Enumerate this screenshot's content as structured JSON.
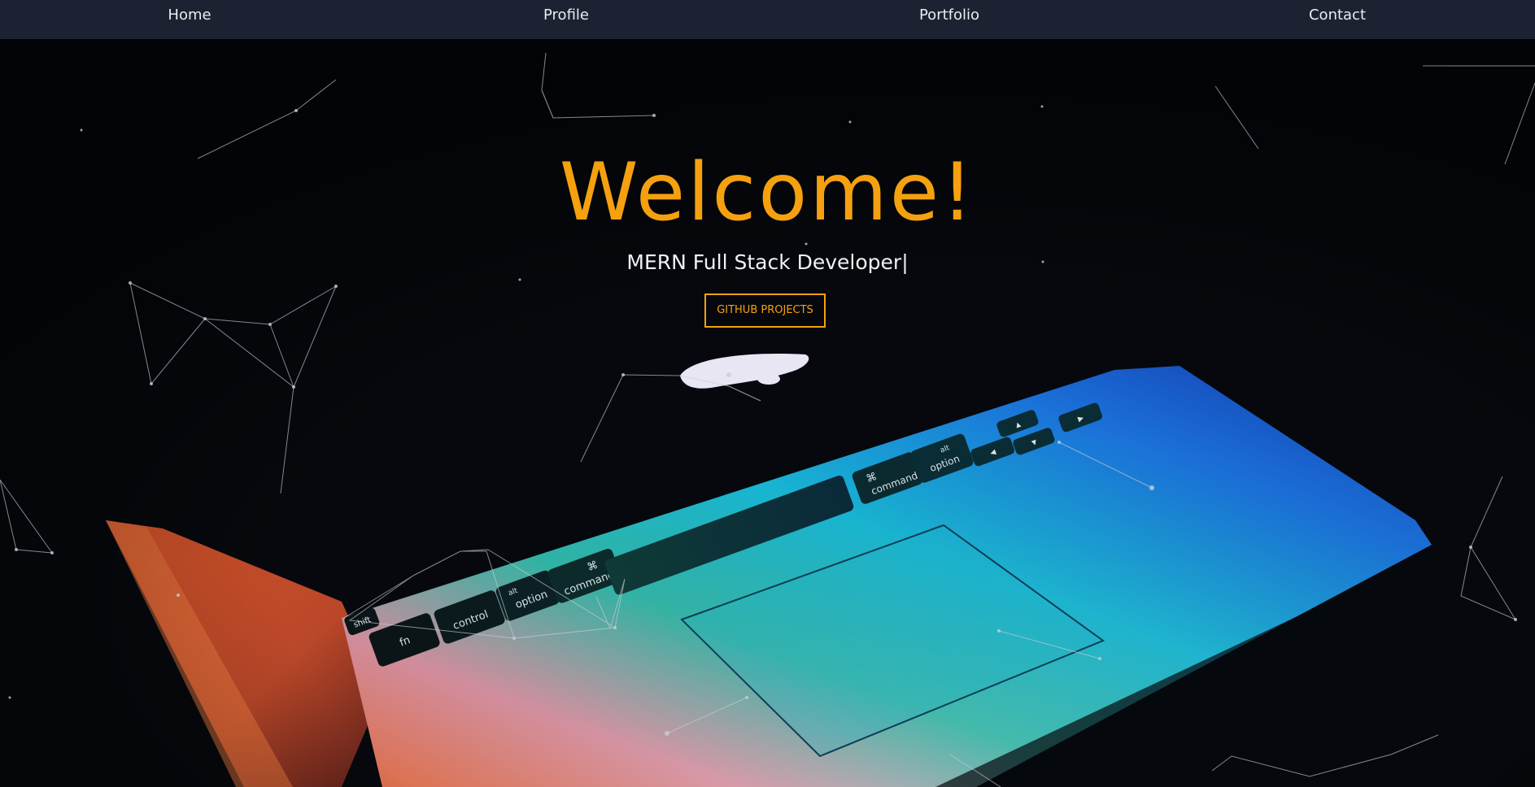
{
  "nav": {
    "home": "Home",
    "profile": "Profile",
    "portfolio": "Portfolio",
    "contact": "Contact"
  },
  "hero": {
    "title": "Welcome!",
    "subtitle": "MERN Full Stack Developer|",
    "cta_label": "GITHUB PROJECTS"
  },
  "keyboard_labels": {
    "fn": "fn",
    "control": "control",
    "option_left": "option",
    "alt_left": "alt",
    "command_left": "command",
    "cmd_symbol_left": "⌘",
    "shift": "shift",
    "command_right": "command",
    "cmd_symbol_right": "⌘",
    "option_right": "option",
    "alt_right": "alt",
    "arrow_left": "◀",
    "arrow_up": "▲",
    "arrow_down": "▼",
    "arrow_right": "▶"
  },
  "colors": {
    "accent": "#f5a10f",
    "navbar_bg": "#1c2231",
    "nav_text": "#e9ecf2",
    "page_bg": "#06080d"
  },
  "icons": {
    "background": "laptop-keyboard-photo",
    "particles": "particle-network-lines"
  }
}
